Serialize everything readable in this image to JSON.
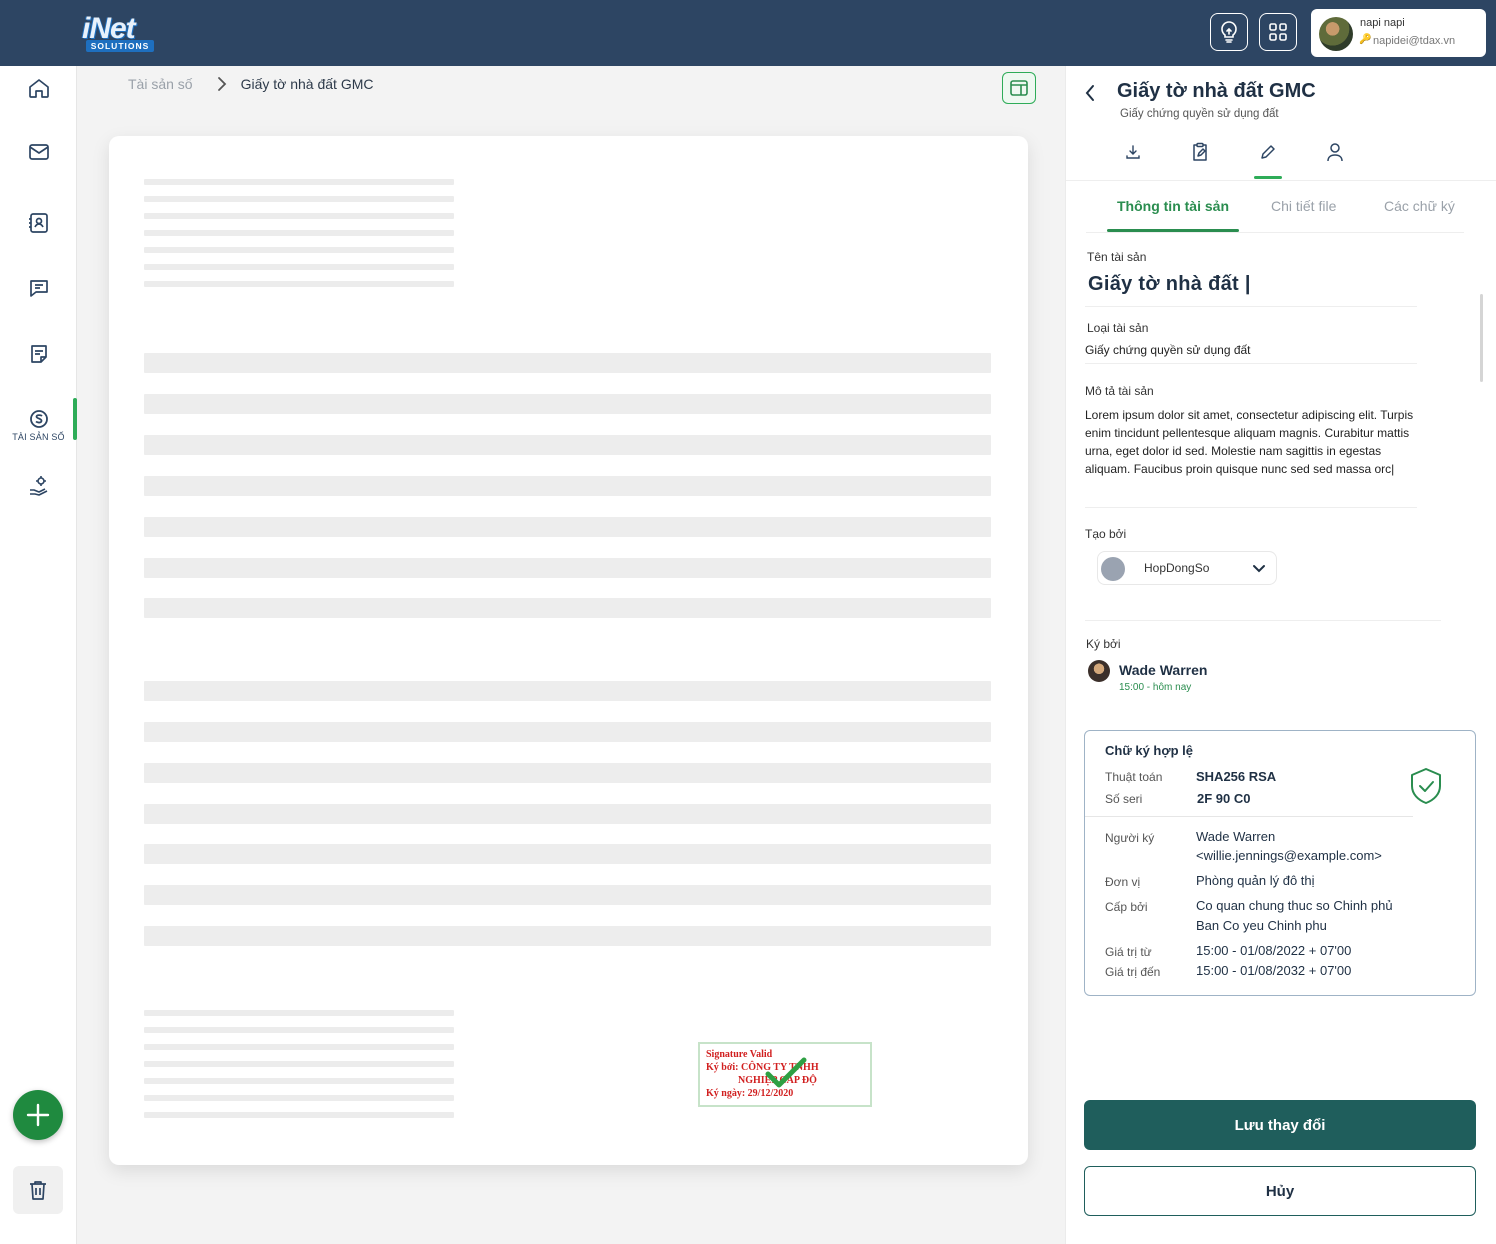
{
  "app": {
    "logo_text": "iNet",
    "logo_sub": "SOLUTIONS",
    "user": {
      "name": "napi napi",
      "email": "napidei@tdax.vn"
    }
  },
  "sidebar": {
    "items": [
      {
        "icon": "home-icon"
      },
      {
        "icon": "mail-icon"
      },
      {
        "icon": "contacts-icon"
      },
      {
        "icon": "chat-icon"
      },
      {
        "icon": "document-icon"
      },
      {
        "icon": "digital-asset-icon",
        "label": "TÀI SẢN SỐ",
        "active": true
      },
      {
        "icon": "settings-hand-icon"
      }
    ],
    "accent_color": "#2eac58"
  },
  "breadcrumb": {
    "root": "Tài sản số",
    "current": "Giấy tờ nhà đất GMC"
  },
  "document": {
    "stamp": {
      "line1": "Signature Valid",
      "line2": "Ký bởi: CÔNG TY TNHH",
      "line3": "NGHIỆP CẤP ĐỘ",
      "line4": "Ký ngày: 29/12/2020"
    }
  },
  "panel": {
    "title": "Giấy tờ nhà đất GMC",
    "subtitle": "Giấy chứng quyền sử dụng đất",
    "tabs": [
      {
        "label": "Thông tin tài sản",
        "active": true
      },
      {
        "label": "Chi tiết file"
      },
      {
        "label": "Các chữ ký"
      }
    ],
    "fields": {
      "name_label": "Tên tài sản",
      "name_value": "Giấy tờ nhà đất |",
      "type_label": "Loại tài sản",
      "type_value": "Giấy chứng quyền sử dụng đất",
      "desc_label": "Mô tả tài sản",
      "desc_value": "Lorem ipsum dolor sit amet, consectetur adipiscing elit. Turpis enim tincidunt pellentesque aliquam magnis. Curabitur mattis urna, eget dolor id sed. Molestie nam sagittis in egestas aliquam. Faucibus proin quisque nunc sed sed massa orc|",
      "creator_label": "Tạo bởi",
      "creator_value": "HopDongSo",
      "signer_label": "Ký bởi",
      "signer_name": "Wade Warren",
      "signer_time": "15:00 - hôm nay"
    },
    "certificate": {
      "title": "Chữ ký hợp lệ",
      "algorithm_label": "Thuật toán",
      "algorithm": "SHA256 RSA",
      "serial_label": "Số seri",
      "serial": "2F 90 C0",
      "signer_label": "Người ký",
      "signer_name": "Wade Warren",
      "signer_email": "<willie.jennings@example.com>",
      "unit_label": "Đơn vị",
      "unit": "Phòng quản lý đô thị",
      "issuer_label": "Cấp bởi",
      "issuer_line1": "Co quan chung thuc so Chinh phủ",
      "issuer_line2": "Ban Co yeu Chinh phu",
      "valid_from_label": "Giá trị từ",
      "valid_from": "15:00 - 01/08/2022 + 07'00",
      "valid_to_label": "Giá trị đến",
      "valid_to": "15:00 - 01/08/2032 + 07'00"
    },
    "save_label": "Lưu thay đổi",
    "cancel_label": "Hủy",
    "primary_color": "#1f5e5c"
  }
}
